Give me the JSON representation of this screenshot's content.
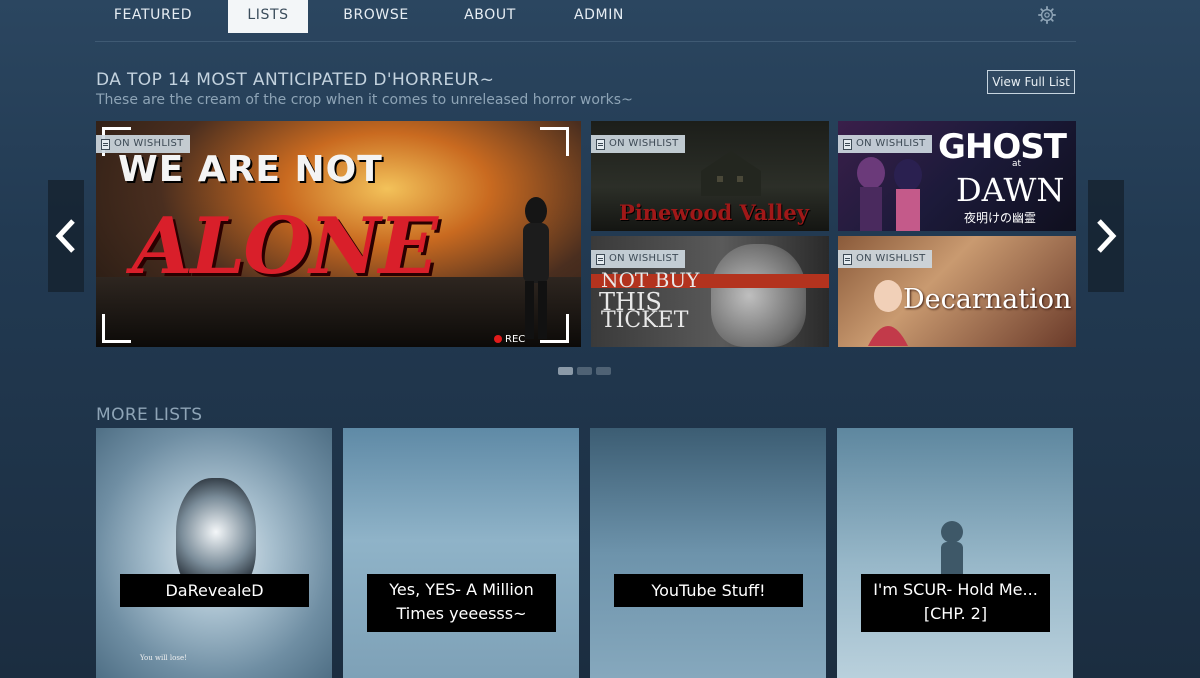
{
  "nav": {
    "items": [
      "FEATURED",
      "LISTS",
      "BROWSE",
      "ABOUT",
      "ADMIN"
    ],
    "active": "LISTS",
    "settings_icon": "gear-icon"
  },
  "featured_list": {
    "title": "DA TOP 14 MOST ANTICIPATED D'HORREUR~",
    "subtitle": "These are the cream of the crop when it comes to unreleased horror works~",
    "view_full_label": "View Full List",
    "badge": "ON WISHLIST",
    "tiles": [
      {
        "title_line1": "WE ARE NOT",
        "title_line2": "ALONE",
        "overlay": "REC"
      },
      {
        "title": "Pinewood Valley"
      },
      {
        "title_line1": "GHOST",
        "title_at": "at",
        "title_line2": "DAWN",
        "title_jp": "夜明けの幽霊"
      },
      {
        "line1": "NOT BUY",
        "line2": "THIS",
        "line3": "TICKET"
      },
      {
        "title": "Decarnation"
      }
    ],
    "page_count": 3,
    "active_page": 1
  },
  "more_lists": {
    "title": "MORE LISTS",
    "cards": [
      {
        "label": "DaRevealeD",
        "caption": "You will lose!"
      },
      {
        "label_line1": "Yes, YES- A Million",
        "label_line2": "Times yeeesss~"
      },
      {
        "label": "YouTube Stuff!"
      },
      {
        "label_line1": "I'm SCUR- Hold Me...",
        "label_line2": "[CHP. 2]"
      }
    ]
  },
  "colors": {
    "background_top": "#2b4660",
    "background_bottom": "#1b2d40",
    "nav_active_bg": "#f3f6f8",
    "accent_red": "#d91f2a"
  }
}
